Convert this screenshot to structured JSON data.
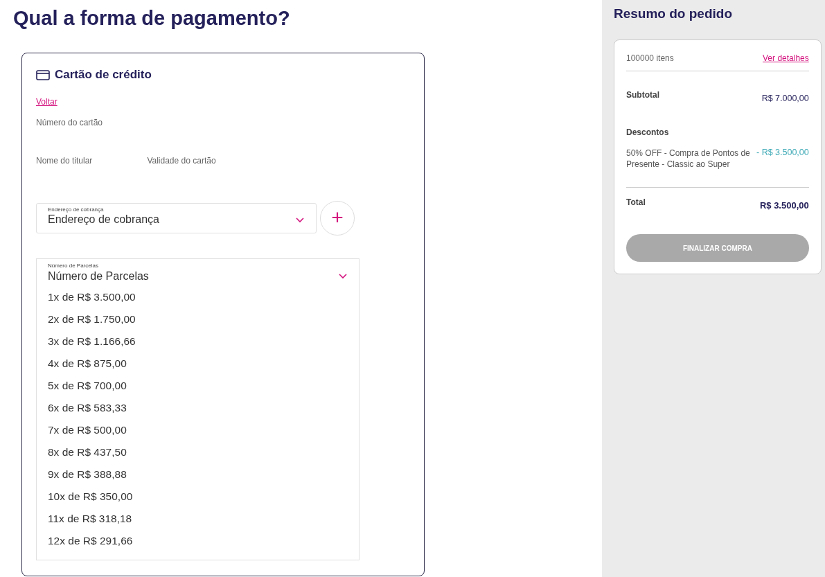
{
  "page_title": "Qual a forma de pagamento?",
  "payment_card": {
    "title": "Cartão de crédito",
    "back_link": "Voltar",
    "fields": [
      {
        "label": "Número do cartão"
      },
      {
        "label": "Nome do titular"
      },
      {
        "label": "Validade do cartão"
      }
    ],
    "billing_select": {
      "floating_label": "Endereço de cobrança",
      "value": "Endereço de cobrança",
      "add_button": "+"
    },
    "installments": {
      "floating_label": "Número de Parcelas",
      "value": "Número de Parcelas",
      "expanded": true,
      "options": [
        "1x de R$ 3.500,00",
        "2x de R$ 1.750,00",
        "3x de R$ 1.166,66",
        "4x de R$ 875,00",
        "5x de R$ 700,00",
        "6x de R$ 583,33",
        "7x de R$ 500,00",
        "8x de R$ 437,50",
        "9x de R$ 388,88",
        "10x de R$ 350,00",
        "11x de R$ 318,18",
        "12x de R$ 291,66"
      ]
    }
  },
  "summary": {
    "title": "Resumo do pedido",
    "items_count": "100000 itens",
    "details_link": "Ver detalhes",
    "subtotal": {
      "label": "Subtotal",
      "value": "R$ 7.000,00"
    },
    "discounts": {
      "label": "Descontos",
      "lines": [
        {
          "description": "50% OFF - Compra de Pontos de Presente - Classic ao Super",
          "value": "- R$ 3.500,00"
        }
      ]
    },
    "total": {
      "label": "Total",
      "value": "R$ 3.500,00"
    },
    "checkout_button": {
      "label": "FINALIZAR COMPRA",
      "disabled": true
    }
  }
}
